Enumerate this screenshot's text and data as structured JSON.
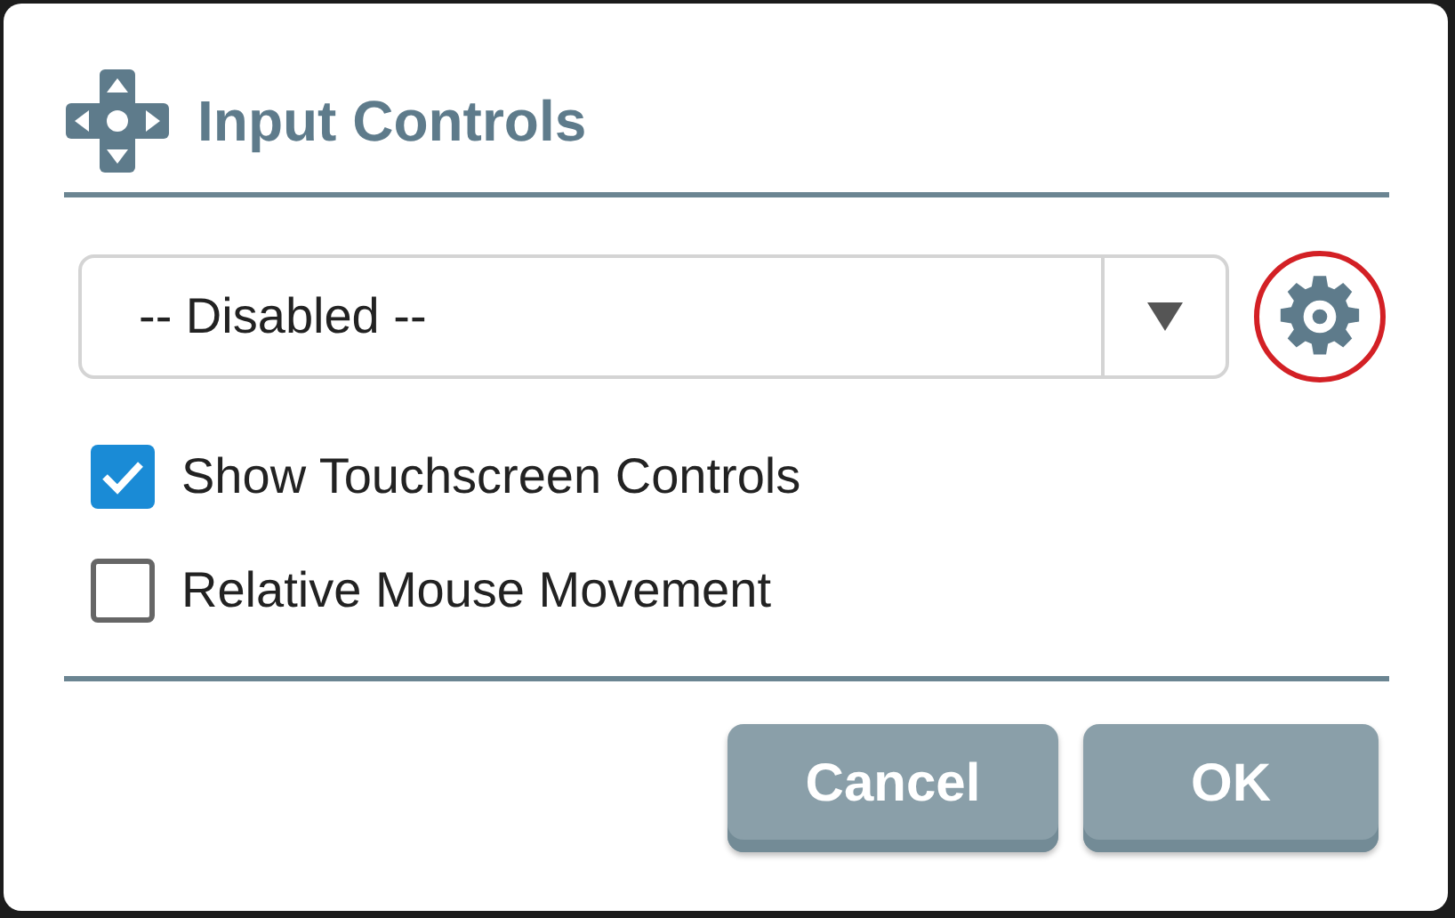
{
  "dialog": {
    "title": "Input Controls"
  },
  "profile_select": {
    "value": "-- Disabled --"
  },
  "settings_button": {
    "highlighted": true
  },
  "options": [
    {
      "label": "Show Touchscreen Controls",
      "checked": true
    },
    {
      "label": "Relative Mouse Movement",
      "checked": false
    }
  ],
  "buttons": [
    "Cancel",
    "OK"
  ]
}
